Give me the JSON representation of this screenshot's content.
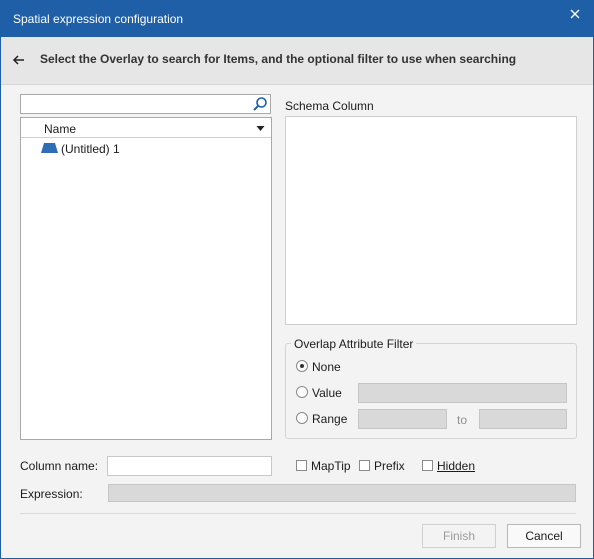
{
  "window": {
    "title": "Spatial expression configuration"
  },
  "header": {
    "instruction": "Select the Overlay to search for Items, and the optional filter to use when searching"
  },
  "search": {
    "value": "",
    "placeholder": ""
  },
  "tree": {
    "column_header": "Name",
    "items": [
      {
        "label": "(Untitled) 1",
        "icon": "overlay-icon"
      }
    ]
  },
  "schema": {
    "label": "Schema Column"
  },
  "filter": {
    "legend": "Overlap Attribute Filter",
    "options": [
      {
        "label": "None",
        "selected": true
      },
      {
        "label": "Value",
        "selected": false
      },
      {
        "label": "Range",
        "selected": false
      }
    ],
    "range_to_label": "to"
  },
  "column_name": {
    "label": "Column name:",
    "value": ""
  },
  "checkboxes": [
    {
      "label": "MapTip",
      "checked": false
    },
    {
      "label": "Prefix",
      "checked": false
    },
    {
      "label": "Hidden",
      "checked": false
    }
  ],
  "expression": {
    "label": "Expression:",
    "value": ""
  },
  "buttons": {
    "finish": "Finish",
    "cancel": "Cancel"
  },
  "colors": {
    "titlebar": "#1f5fa8",
    "icon_blue": "#2f6db5"
  }
}
